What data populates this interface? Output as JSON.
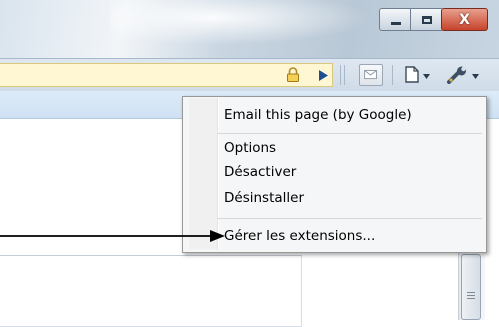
{
  "window": {
    "controls": {
      "minimize_icon": "minimize-icon",
      "maximize_icon": "maximize-icon",
      "close_label": "X"
    }
  },
  "toolbar": {
    "icons": [
      "lock-icon",
      "go-arrow-icon",
      "mail-icon",
      "page-menu-icon",
      "wrench-menu-icon"
    ]
  },
  "menu": {
    "items": [
      {
        "label": "Email this page (by Google)"
      },
      {
        "label": "Options"
      },
      {
        "label": "Désactiver"
      },
      {
        "label": "Désinstaller"
      },
      {
        "label": "Gérer les extensions..."
      }
    ]
  },
  "colors": {
    "address_bar": "#fff7d4",
    "close_button": "#c7432b",
    "menu_background": "#f5f6f7"
  }
}
